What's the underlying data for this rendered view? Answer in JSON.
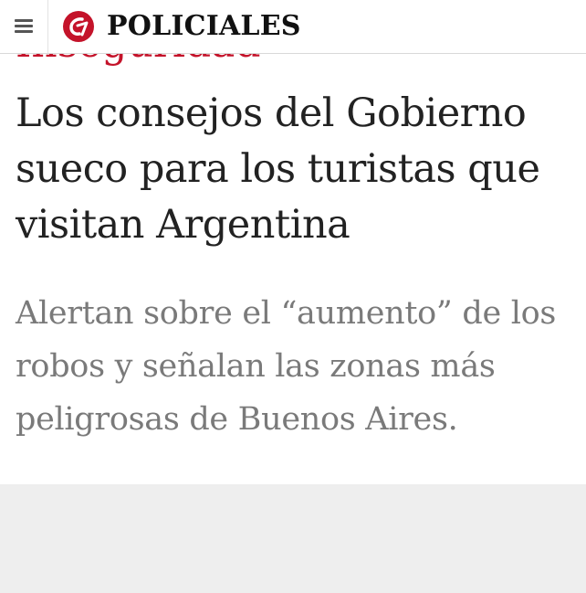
{
  "header": {
    "menu_icon": "hamburger-menu-icon",
    "logo_icon": "clarin-logo-icon",
    "section": "POLICIALES"
  },
  "article": {
    "kicker": "Inseguridad",
    "headline": "Los consejos del Gobierno sueco para los turistas que visitan Argentina",
    "subheadline": "Alertan sobre el “aumento” de los robos y señalan las zonas más peligrosas de Buenos Aires."
  },
  "colors": {
    "brand_red": "#c4132a",
    "headline": "#222222",
    "subheadline": "#7a7a7a",
    "background_gray": "#eeeeee"
  }
}
